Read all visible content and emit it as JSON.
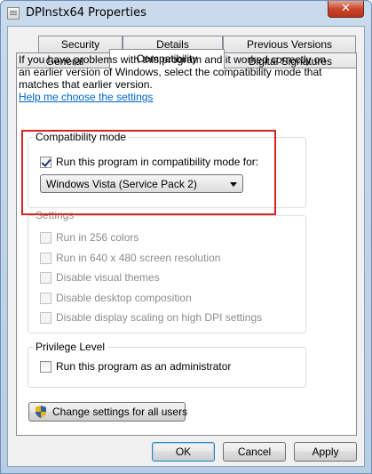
{
  "window": {
    "title": "DPInstx64 Properties",
    "close_glyph": "✕"
  },
  "tabs": {
    "row1": [
      "Security",
      "Details",
      "Previous Versions"
    ],
    "row2": [
      "General",
      "Compatibility",
      "Digital Signatures"
    ],
    "active": "Compatibility"
  },
  "intro_text": "If you have problems with this program and it worked correctly on an earlier version of Windows, select the compatibility mode that matches that earlier version.",
  "help_link": "Help me choose the settings",
  "compat_mode": {
    "group_label": "Compatibility mode",
    "checkbox_label": "Run this program in compatibility mode for:",
    "checked": true,
    "selected_os": "Windows Vista (Service Pack 2)"
  },
  "settings": {
    "group_label": "Settings",
    "items": [
      "Run in 256 colors",
      "Run in 640 x 480 screen resolution",
      "Disable visual themes",
      "Disable desktop composition",
      "Disable display scaling on high DPI settings"
    ]
  },
  "privilege": {
    "group_label": "Privilege Level",
    "checkbox_label": "Run this program as an administrator",
    "checked": false
  },
  "change_all_users_label": "Change settings for all users",
  "footer": {
    "ok": "OK",
    "cancel": "Cancel",
    "apply": "Apply"
  },
  "colors": {
    "highlight": "#d9231f",
    "link": "#0066cc"
  }
}
